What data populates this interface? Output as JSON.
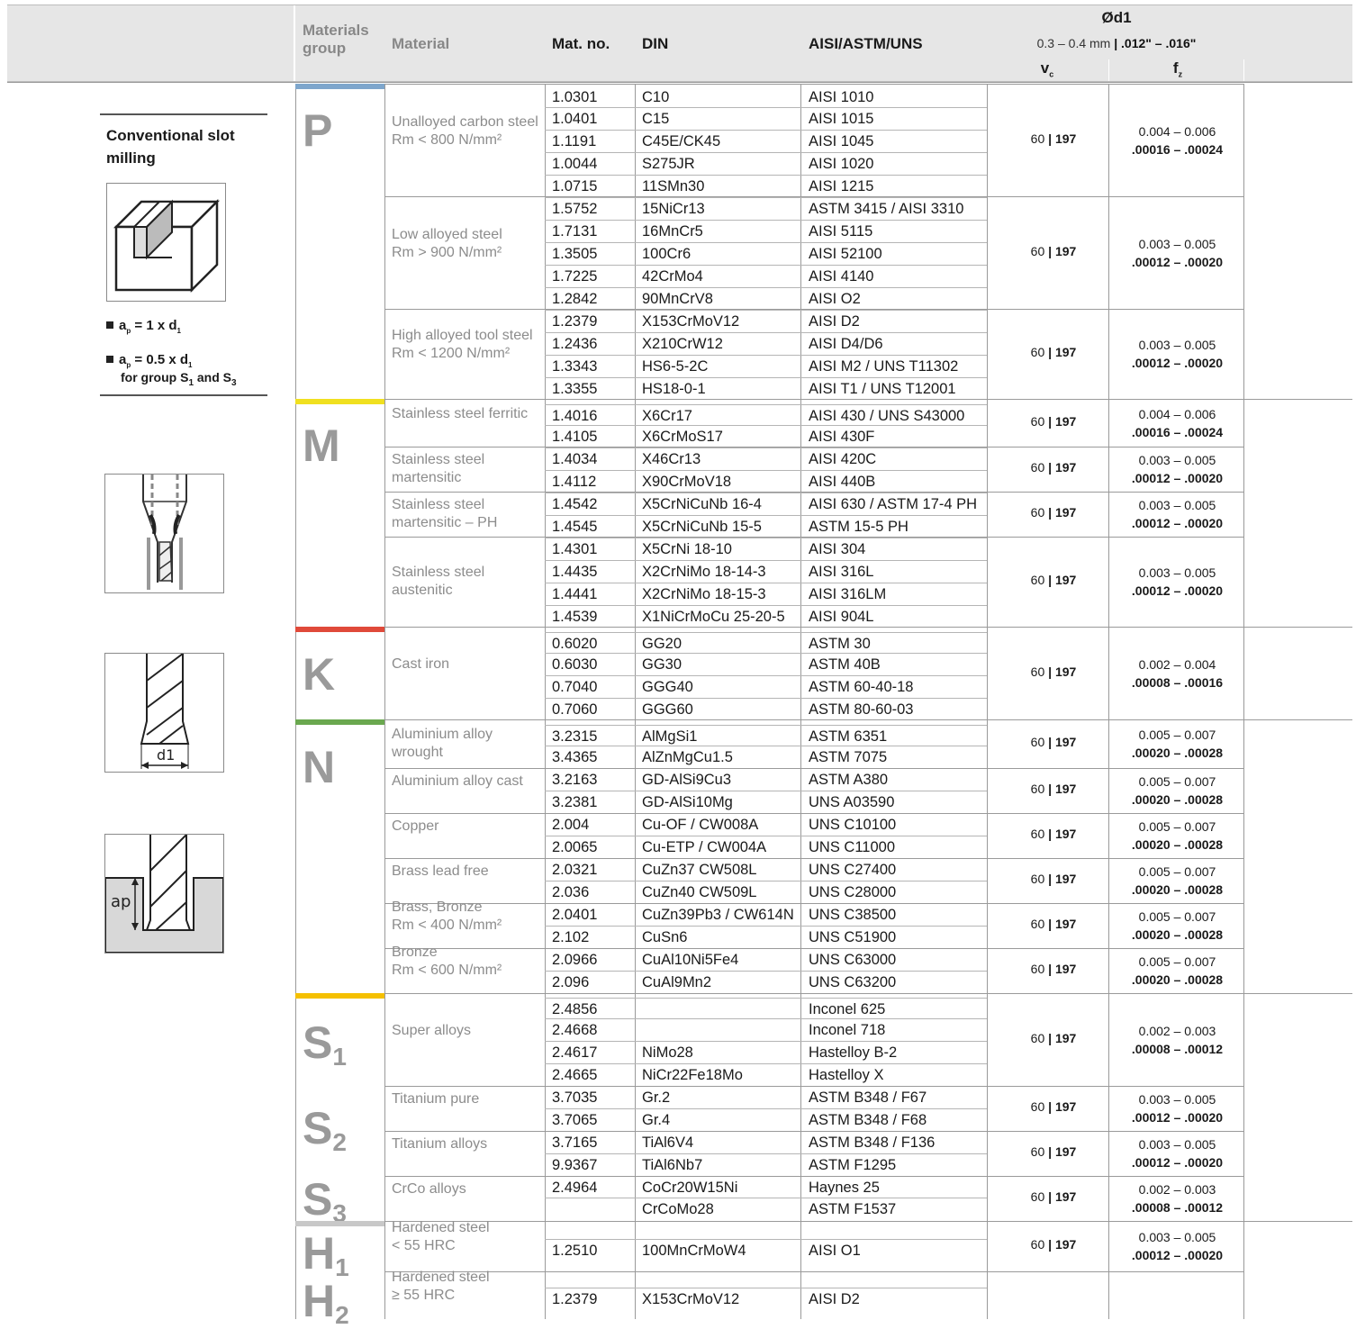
{
  "header": {
    "group_label": "Materials group",
    "material_label": "Material",
    "matno_label": "Mat. no.",
    "din_label": "DIN",
    "aisi_label": "AISI/ASTM/UNS",
    "d1_label": "Ød1",
    "range_metric": "0.3 – 0.4 mm",
    "range_inch": ".012\" – .016\"",
    "vc_label": "v",
    "vc_sub": "c",
    "fz_label": "f",
    "fz_sub": "z"
  },
  "left_panel": {
    "title": "Conventional slot milling",
    "bullet1": "a = 1 x d",
    "bullet2": "a = 0.5 x d",
    "note": "for group S1 and S3",
    "d1_label": "d1",
    "ap_label": "ap"
  },
  "groups": [
    {
      "letter": "P",
      "color": "#7ea6cc"
    },
    {
      "letter": "M",
      "color": "#f0e020"
    },
    {
      "letter": "K",
      "color": "#e04a3a"
    },
    {
      "letter": "N",
      "color": "#6aa84f"
    },
    {
      "letter": "S1",
      "color": "#f5c000"
    },
    {
      "letter": "S2",
      "color": ""
    },
    {
      "letter": "S3",
      "color": ""
    },
    {
      "letter": "H1",
      "color": "#c8c8c8"
    },
    {
      "letter": "H2",
      "color": ""
    }
  ],
  "rows": [
    {
      "matno": "1.0301",
      "din": "C10",
      "aisi": "AISI 1010"
    },
    {
      "matno": "1.0401",
      "din": "C15",
      "aisi": "AISI 1015"
    },
    {
      "matno": "1.1191",
      "din": "C45E/CK45",
      "aisi": "AISI 1045"
    },
    {
      "matno": "1.0044",
      "din": "S275JR",
      "aisi": "AISI 1020"
    },
    {
      "matno": "1.0715",
      "din": "11SMn30",
      "aisi": "AISI 1215"
    },
    {
      "matno": "1.5752",
      "din": "15NiCr13",
      "aisi": "ASTM 3415 / AISI 3310"
    },
    {
      "matno": "1.7131",
      "din": "16MnCr5",
      "aisi": "AISI 5115"
    },
    {
      "matno": "1.3505",
      "din": "100Cr6",
      "aisi": "AISI 52100"
    },
    {
      "matno": "1.7225",
      "din": "42CrMo4",
      "aisi": "AISI 4140"
    },
    {
      "matno": "1.2842",
      "din": "90MnCrV8",
      "aisi": "AISI O2"
    },
    {
      "matno": "1.2379",
      "din": "X153CrMoV12",
      "aisi": "AISI D2"
    },
    {
      "matno": "1.2436",
      "din": "X210CrW12",
      "aisi": "AISI D4/D6"
    },
    {
      "matno": "1.3343",
      "din": "HS6-5-2C",
      "aisi": "AISI M2 / UNS T11302"
    },
    {
      "matno": "1.3355",
      "din": "HS18-0-1",
      "aisi": "AISI T1 / UNS T12001"
    },
    {
      "matno": "1.4016",
      "din": "X6Cr17",
      "aisi": "AISI 430 / UNS S43000"
    },
    {
      "matno": "1.4105",
      "din": "X6CrMoS17",
      "aisi": "AISI 430F"
    },
    {
      "matno": "1.4034",
      "din": "X46Cr13",
      "aisi": "AISI 420C"
    },
    {
      "matno": "1.4112",
      "din": "X90CrMoV18",
      "aisi": "AISI 440B"
    },
    {
      "matno": "1.4542",
      "din": "X5CrNiCuNb 16-4",
      "aisi": "AISI 630 / ASTM 17-4 PH"
    },
    {
      "matno": "1.4545",
      "din": "X5CrNiCuNb 15-5",
      "aisi": "ASTM 15-5 PH"
    },
    {
      "matno": "1.4301",
      "din": "X5CrNi 18-10",
      "aisi": "AISI 304"
    },
    {
      "matno": "1.4435",
      "din": "X2CrNiMo 18-14-3",
      "aisi": "AISI 316L"
    },
    {
      "matno": "1.4441",
      "din": "X2CrNiMo 18-15-3",
      "aisi": "AISI 316LM"
    },
    {
      "matno": "1.4539",
      "din": "X1NiCrMoCu 25-20-5",
      "aisi": "AISI 904L"
    },
    {
      "matno": "0.6020",
      "din": "GG20",
      "aisi": "ASTM 30"
    },
    {
      "matno": "0.6030",
      "din": "GG30",
      "aisi": "ASTM 40B"
    },
    {
      "matno": "0.7040",
      "din": "GGG40",
      "aisi": "ASTM 60-40-18"
    },
    {
      "matno": "0.7060",
      "din": "GGG60",
      "aisi": "ASTM 80-60-03"
    },
    {
      "matno": "3.2315",
      "din": "AlMgSi1",
      "aisi": "ASTM 6351"
    },
    {
      "matno": "3.4365",
      "din": "AlZnMgCu1.5",
      "aisi": "ASTM 7075"
    },
    {
      "matno": "3.2163",
      "din": "GD-AlSi9Cu3",
      "aisi": "ASTM A380"
    },
    {
      "matno": "3.2381",
      "din": "GD-AlSi10Mg",
      "aisi": "UNS A03590"
    },
    {
      "matno": "2.004",
      "din": "Cu-OF / CW008A",
      "aisi": "UNS C10100"
    },
    {
      "matno": "2.0065",
      "din": "Cu-ETP / CW004A",
      "aisi": "UNS C11000"
    },
    {
      "matno": "2.0321",
      "din": "CuZn37 CW508L",
      "aisi": "UNS C27400"
    },
    {
      "matno": "2.036",
      "din": "CuZn40 CW509L",
      "aisi": "UNS C28000"
    },
    {
      "matno": "2.0401",
      "din": "CuZn39Pb3 / CW614N",
      "aisi": "UNS C38500"
    },
    {
      "matno": "2.102",
      "din": "CuSn6",
      "aisi": "UNS C51900"
    },
    {
      "matno": "2.0966",
      "din": "CuAl10Ni5Fe4",
      "aisi": "UNS C63000"
    },
    {
      "matno": "2.096",
      "din": "CuAl9Mn2",
      "aisi": "UNS C63200"
    },
    {
      "matno": "2.4856",
      "din": "",
      "aisi": "Inconel 625"
    },
    {
      "matno": "2.4668",
      "din": "",
      "aisi": "Inconel 718"
    },
    {
      "matno": "2.4617",
      "din": "NiMo28",
      "aisi": "Hastelloy B-2"
    },
    {
      "matno": "2.4665",
      "din": "NiCr22Fe18Mo",
      "aisi": "Hastelloy X"
    },
    {
      "matno": "3.7035",
      "din": "Gr.2",
      "aisi": "ASTM B348 / F67"
    },
    {
      "matno": "3.7065",
      "din": "Gr.4",
      "aisi": "ASTM B348 / F68"
    },
    {
      "matno": "3.7165",
      "din": "TiAl6V4",
      "aisi": "ASTM B348 / F136"
    },
    {
      "matno": "9.9367",
      "din": "TiAl6Nb7",
      "aisi": "ASTM F1295"
    },
    {
      "matno": "2.4964",
      "din": "CoCr20W15Ni",
      "aisi": "Haynes 25"
    },
    {
      "matno": "",
      "din": "CrCoMo28",
      "aisi": "ASTM F1537"
    },
    {
      "matno": "1.2510",
      "din": "100MnCrMoW4",
      "aisi": "AISI O1"
    },
    {
      "matno": "1.2379",
      "din": "X153CrMoV12",
      "aisi": "AISI D2"
    }
  ],
  "materials": [
    {
      "name": "Unalloyed carbon steel",
      "note": "Rm < 800 N/mm²",
      "vc": "60",
      "vc_in": "197",
      "fz": "0.004 – 0.006",
      "fz_in": ".00016 – .00024"
    },
    {
      "name": "Low alloyed steel",
      "note": "Rm > 900 N/mm²",
      "vc": "60",
      "vc_in": "197",
      "fz": "0.003 – 0.005",
      "fz_in": ".00012 – .00020"
    },
    {
      "name": "High alloyed tool steel",
      "note": "Rm < 1200 N/mm²",
      "vc": "60",
      "vc_in": "197",
      "fz": "0.003 – 0.005",
      "fz_in": ".00012 – .00020"
    },
    {
      "name": "Stainless steel ferritic",
      "note": "",
      "vc": "60",
      "vc_in": "197",
      "fz": "0.004 – 0.006",
      "fz_in": ".00016 – .00024"
    },
    {
      "name": "Stainless steel martensitic",
      "note": "",
      "vc": "60",
      "vc_in": "197",
      "fz": "0.003 – 0.005",
      "fz_in": ".00012 – .00020"
    },
    {
      "name": "Stainless steel martensitic – PH",
      "note": "",
      "vc": "60",
      "vc_in": "197",
      "fz": "0.003 – 0.005",
      "fz_in": ".00012 – .00020"
    },
    {
      "name": "Stainless steel austenitic",
      "note": "",
      "vc": "60",
      "vc_in": "197",
      "fz": "0.003 – 0.005",
      "fz_in": ".00012 – .00020"
    },
    {
      "name": "Cast iron",
      "note": "",
      "vc": "60",
      "vc_in": "197",
      "fz": "0.002 – 0.004",
      "fz_in": ".00008 – .00016"
    },
    {
      "name": "Aluminium alloy wrought",
      "note": "",
      "vc": "60",
      "vc_in": "197",
      "fz": "0.005 – 0.007",
      "fz_in": ".00020 – .00028"
    },
    {
      "name": "Aluminium alloy cast",
      "note": "",
      "vc": "60",
      "vc_in": "197",
      "fz": "0.005 – 0.007",
      "fz_in": ".00020 – .00028"
    },
    {
      "name": "Copper",
      "note": "",
      "vc": "60",
      "vc_in": "197",
      "fz": "0.005 – 0.007",
      "fz_in": ".00020 – .00028"
    },
    {
      "name": "Brass lead free",
      "note": "",
      "vc": "60",
      "vc_in": "197",
      "fz": "0.005 – 0.007",
      "fz_in": ".00020 – .00028"
    },
    {
      "name": "Brass, Bronze",
      "note": "Rm < 400 N/mm²",
      "vc": "60",
      "vc_in": "197",
      "fz": "0.005 – 0.007",
      "fz_in": ".00020 – .00028"
    },
    {
      "name": "Bronze",
      "note": "Rm < 600 N/mm²",
      "vc": "60",
      "vc_in": "197",
      "fz": "0.005 – 0.007",
      "fz_in": ".00020 – .00028"
    },
    {
      "name": "Super alloys",
      "note": "",
      "vc": "60",
      "vc_in": "197",
      "fz": "0.002 – 0.003",
      "fz_in": ".00008 – .00012"
    },
    {
      "name": "Titanium pure",
      "note": "",
      "vc": "60",
      "vc_in": "197",
      "fz": "0.003 – 0.005",
      "fz_in": ".00012 – .00020"
    },
    {
      "name": "Titanium alloys",
      "note": "",
      "vc": "60",
      "vc_in": "197",
      "fz": "0.003 – 0.005",
      "fz_in": ".00012 – .00020"
    },
    {
      "name": "CrCo alloys",
      "note": "",
      "vc": "60",
      "vc_in": "197",
      "fz": "0.002 – 0.003",
      "fz_in": ".00008 – .00012"
    },
    {
      "name": "Hardened steel",
      "note": "< 55 HRC",
      "vc": "60",
      "vc_in": "197",
      "fz": "0.003 – 0.005",
      "fz_in": ".00012 – .00020"
    },
    {
      "name": "Hardened steel",
      "note": "≥ 55 HRC",
      "vc": "",
      "vc_in": "",
      "fz": "",
      "fz_in": ""
    }
  ]
}
